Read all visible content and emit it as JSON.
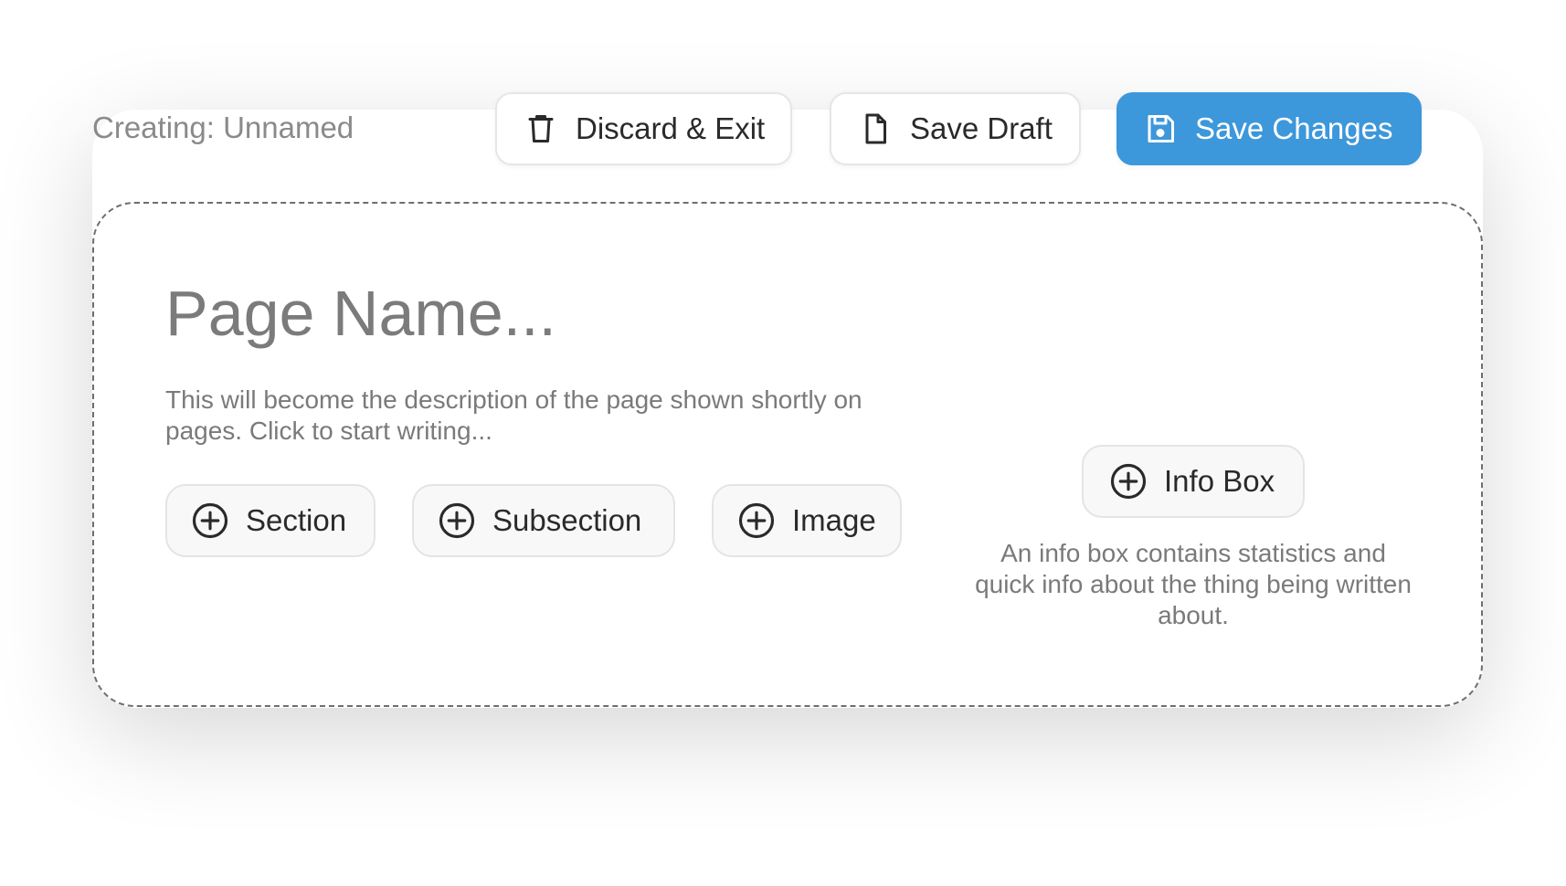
{
  "header": {
    "status_text": "Creating: Unnamed",
    "discard_label": "Discard & Exit",
    "draft_label": "Save Draft",
    "save_label": "Save Changes"
  },
  "editor": {
    "title_placeholder": "Page Name...",
    "description_placeholder": "This will become the description of the page shown shortly on pages. Click to start writing...",
    "add_buttons": {
      "section": "Section",
      "subsection": "Subsection",
      "image": "Image"
    },
    "info_box": {
      "label": "Info Box",
      "description": "An info box contains statistics and quick info about the thing being written about."
    }
  },
  "icons": {
    "discard": "trash-icon",
    "draft": "file-icon",
    "save": "floppy-disk-icon",
    "add": "plus-circle-icon"
  },
  "colors": {
    "accent": "#3d97db",
    "muted_text": "#7a7a7a",
    "dashed_border": "#6e6e6e"
  }
}
